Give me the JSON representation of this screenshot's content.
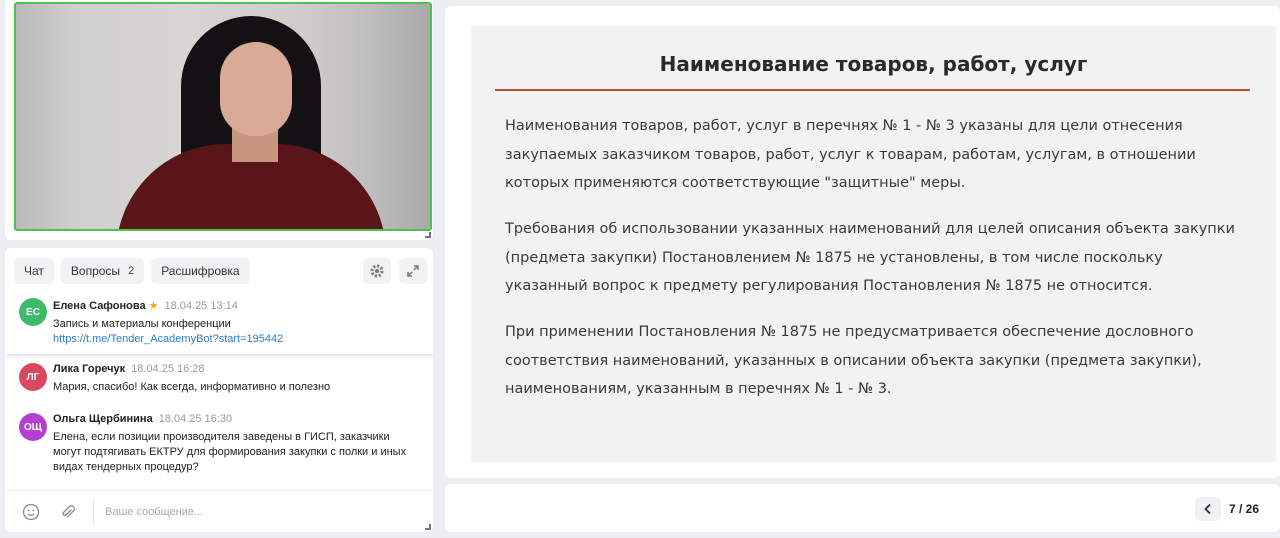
{
  "chat": {
    "tabs": [
      {
        "label": "Чат"
      },
      {
        "label": "Вопросы",
        "count": "2"
      },
      {
        "label": "Расшифровка"
      }
    ],
    "messages": [
      {
        "initials": "ЕС",
        "avatar_color": "#3dbb6b",
        "author": "Елена Сафонова",
        "time": "18.04.25 13:14",
        "line1": "Запись и материалы конференции",
        "link": "https://t.me/Tender_AcademyBot?start=195442"
      },
      {
        "initials": "ЛГ",
        "avatar_color": "#d9485f",
        "author": "Лика Горечук",
        "time": "18.04.25 16:28",
        "text": "Мария, спасибо! Как всегда, информативно и полезно"
      },
      {
        "initials": "ОЩ",
        "avatar_color": "#b43fd1",
        "author": "Ольга Щербинина",
        "time": "18.04.25 16:30",
        "text": "Елена, если позиции производителя заведены в ГИСП, заказчики могут подтягивать ЕКТРУ для формирования закупки с полки и иных видах тендерных процедур?"
      }
    ],
    "input_placeholder": "Ваше сообщение...",
    "icons": {
      "settings": "gear-icon",
      "expand": "expand-icon",
      "emoji": "smile-icon",
      "attach": "paperclip-icon"
    }
  },
  "slide": {
    "title": "Наименование товаров, работ, услуг",
    "paragraphs": [
      "Наименования товаров, работ, услуг в перечнях № 1 - № 3 указаны для цели отнесения закупаемых заказчиком товаров, работ, услуг к товарам, работам, услугам, в отношении которых применяются соответствующие \"защитные\" меры.",
      "Требования об использовании указанных наименований для целей описания объекта закупки (предмета закупки) Постановлением № 1875 не установлены, в том числе поскольку указанный вопрос к предмету регулирования Постановления № 1875 не относится.",
      "При применении Постановления № 1875 не предусматривается обеспечение дословного соответствия наименований, указанных в описании объекта закупки (предмета закупки), наименованиям, указанным в перечнях № 1 - № 3."
    ],
    "accent_color": "#c0483a"
  },
  "pager": {
    "prev_icon": "chevron-left-icon",
    "page": "7 / 26"
  }
}
